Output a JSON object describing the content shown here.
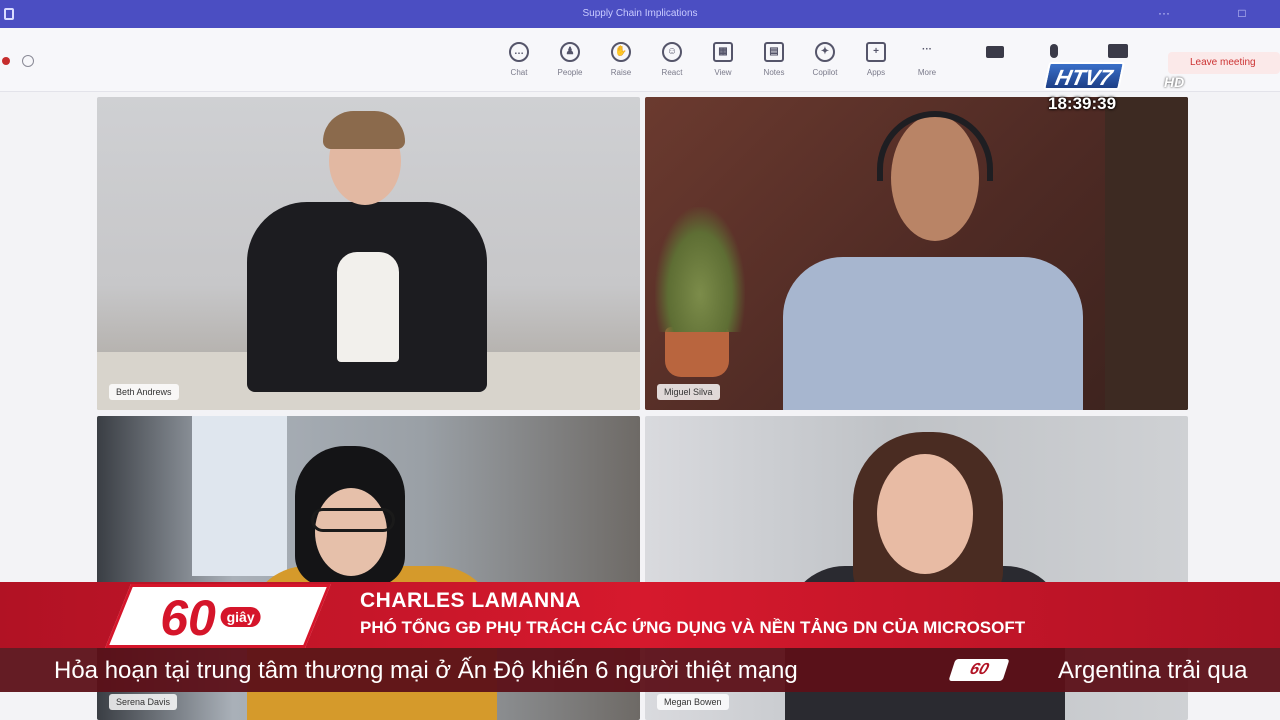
{
  "window": {
    "title": "Supply Chain Implications",
    "controls": [
      "···",
      "□",
      "×"
    ]
  },
  "toolbar": {
    "items": [
      {
        "label": "Chat",
        "icon": "chat-icon",
        "glyph": "…"
      },
      {
        "label": "People",
        "icon": "people-icon",
        "glyph": "♟"
      },
      {
        "label": "Raise",
        "icon": "raise-hand-icon",
        "glyph": "✋"
      },
      {
        "label": "React",
        "icon": "react-icon",
        "glyph": "☺"
      },
      {
        "label": "View",
        "icon": "view-icon",
        "glyph": "▦"
      },
      {
        "label": "Notes",
        "icon": "notes-icon",
        "glyph": "▤"
      },
      {
        "label": "Copilot",
        "icon": "copilot-icon",
        "glyph": "✦"
      },
      {
        "label": "Apps",
        "icon": "apps-icon",
        "glyph": "+"
      },
      {
        "label": "More",
        "icon": "more-icon",
        "glyph": "···"
      },
      {
        "label": "Camera",
        "icon": "camera-icon",
        "glyph": ""
      }
    ],
    "leave_label": "Leave meeting"
  },
  "channel": {
    "logo_text": "HTV7",
    "logo_suffix": "HD",
    "clock": "18:39:39"
  },
  "participants": [
    {
      "name": "Beth Andrews"
    },
    {
      "name": "Miguel Silva"
    },
    {
      "name": "Serena Davis"
    },
    {
      "name": "Megan Bowen"
    }
  ],
  "lower_third": {
    "logo_number": "60",
    "logo_word": "giây",
    "speaker_name": "CHARLES LAMANNA",
    "speaker_title": "PHÓ TỔNG GĐ PHỤ TRÁCH CÁC ỨNG DỤNG VÀ NỀN TẢNG DN CỦA MICROSOFT"
  },
  "ticker": {
    "headline": "Hỏa hoạn tại trung tâm thương mại ở Ấn Độ khiến 6 người thiệt mạng",
    "logo_text": "60",
    "next_headline": "Argentina trải qua"
  }
}
